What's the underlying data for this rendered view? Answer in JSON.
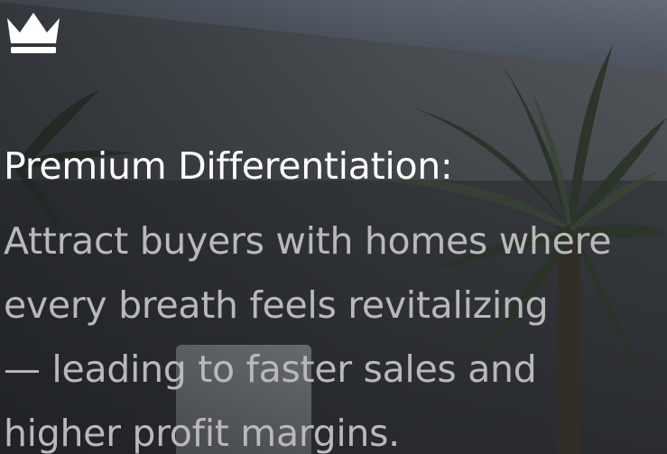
{
  "hero": {
    "icon": "crown-icon",
    "heading": "Premium Differentiation:",
    "body_lines": [
      "Attract buyers with homes where",
      "every breath feels revitalizing",
      "— leading to faster sales and",
      "higher profit margins."
    ]
  },
  "colors": {
    "heading": "#ffffff",
    "body": "#b9b9b9",
    "icon": "#ffffff"
  }
}
